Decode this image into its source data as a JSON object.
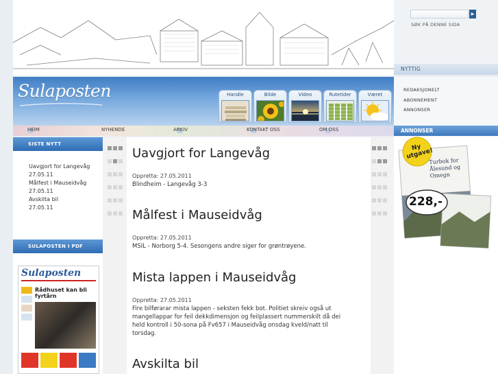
{
  "site": {
    "logo_text": "Sulaposten"
  },
  "icon_tabs": [
    {
      "label": "Handle",
      "icon": "newspapers-icon"
    },
    {
      "label": "Bilde",
      "icon": "sunflower-icon"
    },
    {
      "label": "Video",
      "icon": "sunset-icon"
    },
    {
      "label": "Rutetider",
      "icon": "timetable-icon"
    },
    {
      "label": "Været",
      "icon": "weather-sun-cloud-icon"
    }
  ],
  "nav": {
    "items": [
      "HEIM",
      "NYHENDE",
      "ARKIV",
      "KONTAKT OSS",
      "OM OSS"
    ]
  },
  "left": {
    "latest_heading": "SISTE NYTT",
    "latest": [
      {
        "title": "Uavgjort for Langevåg",
        "date": "27.05.11"
      },
      {
        "title": "Målfest i Mauseidvåg",
        "date": "27.05.11"
      },
      {
        "title": "Avskilta bil",
        "date": "27.05.11"
      }
    ],
    "pdf_heading": "SULAPOSTEN I PDF",
    "pdf_cover": {
      "masthead": "Sulaposten",
      "headline": "Rådhuset kan bli fyrtårn"
    }
  },
  "articles": [
    {
      "title": "Uavgjort for Langevåg",
      "meta": "Oppretta: 27.05.2011",
      "body": "Blindheim - Langevåg 3-3"
    },
    {
      "title": "Målfest i Mauseidvåg",
      "meta": "Oppretta: 27.05.2011",
      "body": "MSIL - Norborg 5-4. Sesongens andre siger for grøntrøyene."
    },
    {
      "title": "Mista lappen i Mauseidvåg",
      "meta": "Oppretta: 27.05.2011",
      "body": "Fire bilførarar mista lappen - seksten fekk bot. Politiet skreiv også ut mangellappar for feil dekkdimensjon og feilplassert nummerskilt då dei held kontroll i 50-sona på Fv657 i Mauseidvåg onsdag kveld/natt til torsdag."
    },
    {
      "title": "Avskilta bil",
      "meta": "",
      "body": ""
    }
  ],
  "right": {
    "search_placeholder": "",
    "search_label": "SØK PÅ DENNE SIDA",
    "useful_heading": "NYTTIG",
    "useful_links": [
      "REDAKSJONELT",
      "ABONNEMENT",
      "ANNONSER"
    ],
    "ads_heading": "ANNONSER",
    "ad": {
      "badge": "Ny utgave!",
      "book_title": "Turbok for Ålesund og Omegn",
      "price": "228,-"
    }
  },
  "colors": {
    "accent_blue": "#2f6db3",
    "badge_yellow": "#f2d21b"
  }
}
